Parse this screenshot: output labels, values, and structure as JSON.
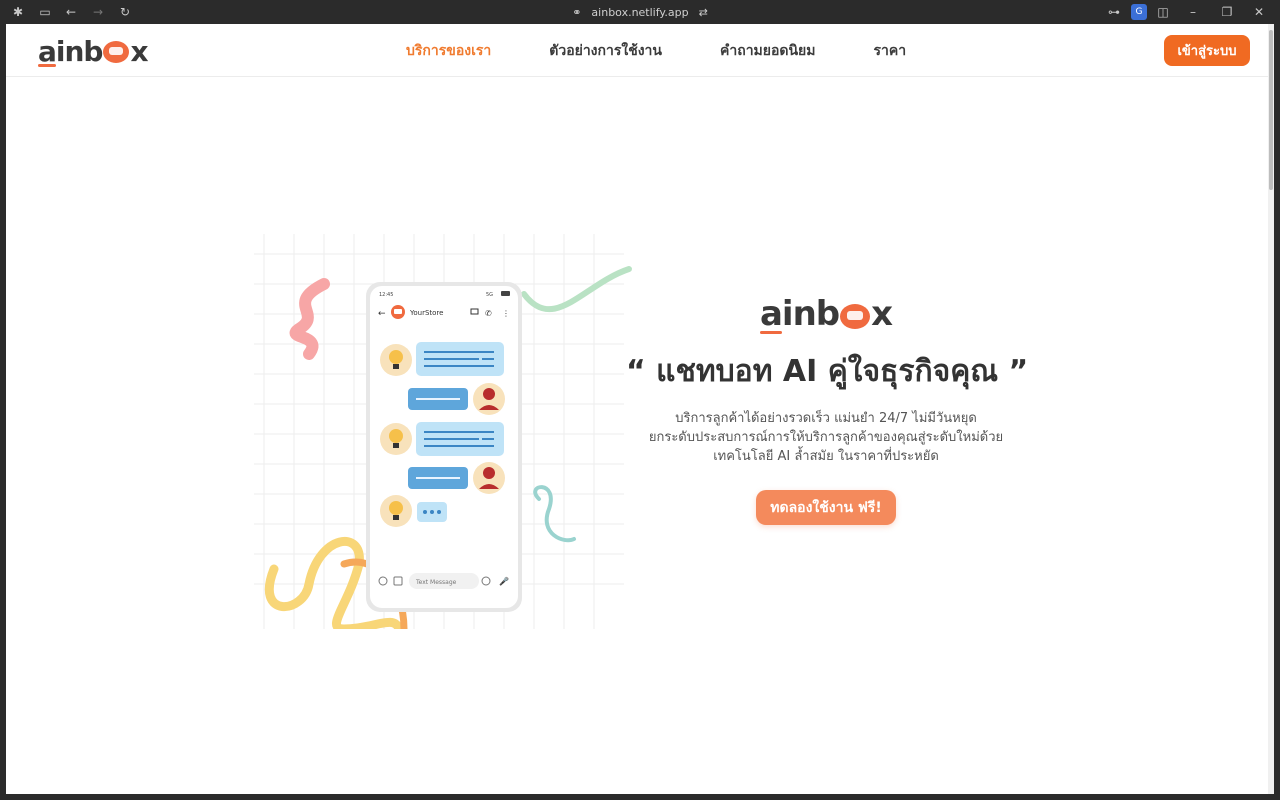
{
  "browser": {
    "url": "ainbox.netlify.app"
  },
  "header": {
    "logo": {
      "left": "ai",
      "mid": "nb",
      "right": "x"
    },
    "nav": [
      {
        "label": "บริการของเรา",
        "active": true
      },
      {
        "label": "ตัวอย่างการใช้งาน",
        "active": false
      },
      {
        "label": "คำถามยอดนิยม",
        "active": false
      },
      {
        "label": "ราคา",
        "active": false
      }
    ],
    "login_label": "เข้าสู่ระบบ"
  },
  "hero": {
    "logo": {
      "left": "ai",
      "mid": "nb",
      "right": "x"
    },
    "title": "“ แชทบอท AI คู่ใจธุรกิจคุณ ”",
    "desc_lines": [
      "บริการลูกค้าได้อย่างรวดเร็ว แม่นยำ 24/7 ไม่มีวันหยุด",
      "ยกระดับประสบการณ์การให้บริการลูกค้าของคุณสู่ระดับใหม่ด้วย",
      "เทคโนโลยี AI ล้ำสมัย ในราคาที่ประหยัด"
    ],
    "cta_label": "ทดลองใช้งาน ฟรี!"
  },
  "phone": {
    "time": "12:45",
    "signal": "5G",
    "store_name": "YourStore",
    "input_placeholder": "Text Message"
  },
  "colors": {
    "accent": "#f06a22",
    "nav_active": "#f07b2f",
    "cta": "#f48a5c"
  }
}
